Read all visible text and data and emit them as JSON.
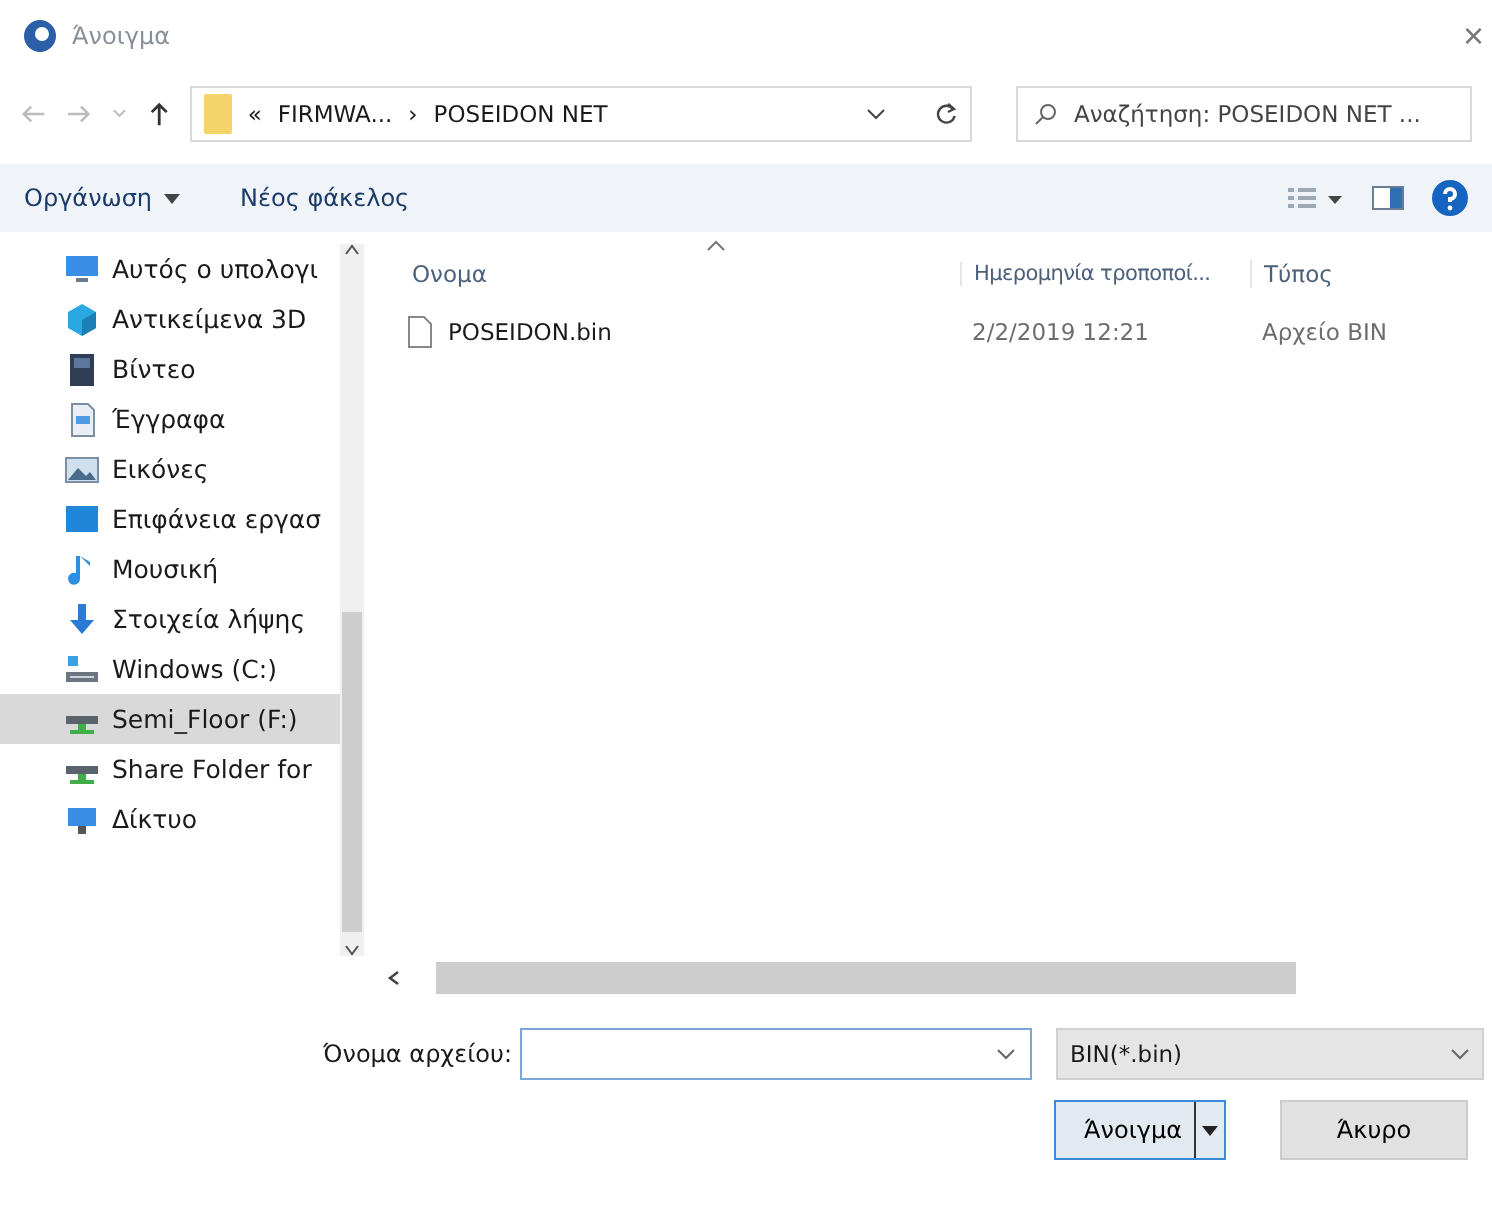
{
  "window": {
    "title": "Άνοιγμα",
    "close": "×"
  },
  "address": {
    "overflow": "«",
    "segments": [
      "FIRMWA...",
      "POSEIDON NET"
    ],
    "separator": "›"
  },
  "search": {
    "placeholder": "Αναζήτηση: POSEIDON NET ..."
  },
  "toolbar": {
    "organize": "Οργάνωση",
    "new_folder": "Νέος φάκελος"
  },
  "sidebar": {
    "items": [
      {
        "label": "Αυτός ο υπολογι",
        "kind": "computer",
        "selected": false
      },
      {
        "label": "Αντικείμενα 3D",
        "kind": "cube",
        "selected": false
      },
      {
        "label": "Βίντεο",
        "kind": "video",
        "selected": false
      },
      {
        "label": "Έγγραφα",
        "kind": "document",
        "selected": false
      },
      {
        "label": "Εικόνες",
        "kind": "pictures",
        "selected": false
      },
      {
        "label": "Επιφάνεια εργασ",
        "kind": "desktop",
        "selected": false
      },
      {
        "label": "Μουσική",
        "kind": "music",
        "selected": false
      },
      {
        "label": "Στοιχεία λήψης",
        "kind": "download",
        "selected": false
      },
      {
        "label": "Windows (C:)",
        "kind": "system-drive",
        "selected": false
      },
      {
        "label": "Semi_Floor (F:)",
        "kind": "drive",
        "selected": true
      },
      {
        "label": "Share Folder for",
        "kind": "drive",
        "selected": false
      },
      {
        "label": "Δίκτυο",
        "kind": "network",
        "selected": false
      }
    ]
  },
  "table": {
    "columns": [
      "Ονομα",
      "Ημερομηνία τροποποί...",
      "Τύπος"
    ],
    "rows": [
      {
        "name": "POSEIDON.bin",
        "date": "2/2/2019 12:21",
        "type": "Αρχείο BIN"
      }
    ]
  },
  "footer": {
    "filename_label": "Όνομα αρχείου:",
    "filter": "BIN(*.bin)",
    "open_button": "Άνοιγμα",
    "cancel_button": "Άκυρο"
  }
}
